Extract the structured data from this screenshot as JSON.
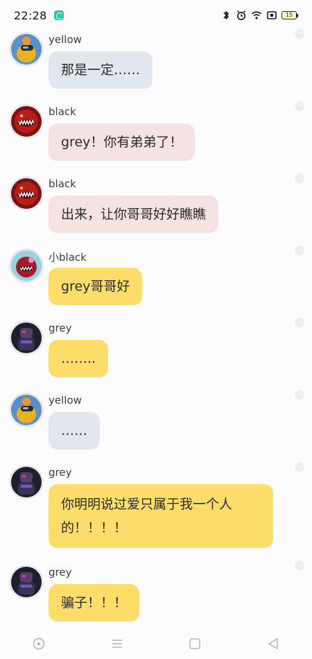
{
  "status_bar": {
    "time": "22:28",
    "battery": "15",
    "icons": [
      "app-badge-icon",
      "bluetooth-icon",
      "alarm-icon",
      "wifi-icon",
      "sim-icon",
      "battery-icon"
    ]
  },
  "messages": [
    {
      "sender": "yellow",
      "text": "那是一定……",
      "bubble_color": "#e2e7ee",
      "avatar": "yellow-crewmate-avatar"
    },
    {
      "sender": "black",
      "text": "grey！你有弟弟了！",
      "bubble_color": "#f5e2e3",
      "avatar": "black-monster-avatar"
    },
    {
      "sender": "black",
      "text": "出来，让你哥哥好好瞧瞧",
      "bubble_color": "#f5e2e3",
      "avatar": "black-monster-avatar"
    },
    {
      "sender": "小black",
      "text": "grey哥哥好",
      "bubble_color": "#fdde6b",
      "avatar": "small-black-avatar"
    },
    {
      "sender": "grey",
      "text": "……..",
      "bubble_color": "#fdde6b",
      "avatar": "grey-avatar"
    },
    {
      "sender": "yellow",
      "text": "……",
      "bubble_color": "#e2e7ee",
      "avatar": "yellow-crewmate-avatar"
    },
    {
      "sender": "grey",
      "text": "你明明说过爱只属于我一个人的！！！！",
      "bubble_color": "#fdde6b",
      "avatar": "grey-avatar"
    },
    {
      "sender": "grey",
      "text": "骗子！！！",
      "bubble_color": "#fdde6b",
      "avatar": "grey-avatar"
    }
  ],
  "nav_bar": {
    "buttons": [
      "assistant-icon",
      "menu-icon",
      "home-icon",
      "back-icon"
    ]
  }
}
